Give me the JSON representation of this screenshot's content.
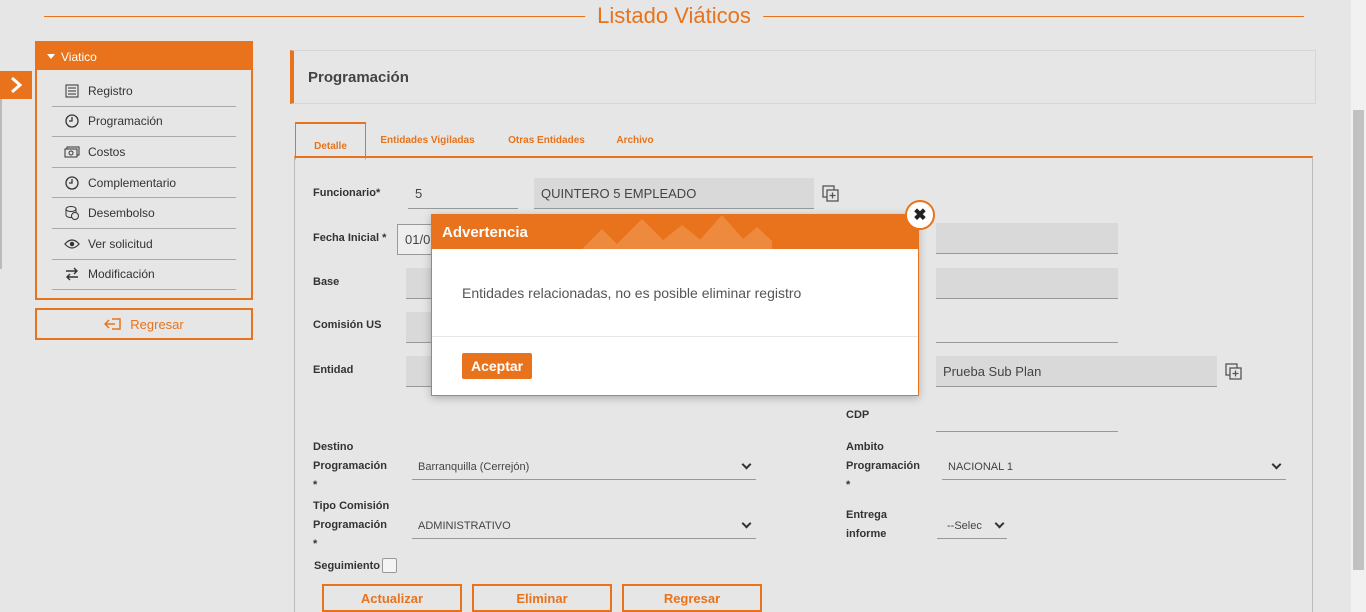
{
  "page": {
    "title": "Listado Viáticos"
  },
  "sidebar": {
    "header": "Viatico",
    "items": [
      {
        "label": "Registro",
        "icon": "list-icon"
      },
      {
        "label": "Programación",
        "icon": "clock-icon"
      },
      {
        "label": "Costos",
        "icon": "money-icon"
      },
      {
        "label": "Complementario",
        "icon": "clock-icon"
      },
      {
        "label": "Desembolso",
        "icon": "coins-icon"
      },
      {
        "label": "Ver solicitud",
        "icon": "eye-icon"
      },
      {
        "label": "Modificación",
        "icon": "swap-icon"
      }
    ],
    "back_label": "Regresar"
  },
  "section": {
    "title": "Programación"
  },
  "tabs": [
    "Detalle",
    "Entidades Vigiladas",
    "Otras Entidades",
    "Archivo"
  ],
  "form": {
    "funcionario_label": "Funcionario*",
    "funcionario_id": "5",
    "funcionario_name": "QUINTERO 5 EMPLEADO",
    "fecha_inicial_label": "Fecha Inicial *",
    "fecha_inicial_value": "01/0",
    "base_label": "Base",
    "comision_label": "Comisión US",
    "entidad_label": "Entidad",
    "subplan_value": "Prueba Sub Plan",
    "cdp_label": "CDP",
    "destino_label_1": "Destino",
    "destino_label_2": "Programación",
    "destino_label_3": "*",
    "destino_value": "Barranquilla (Cerrejón)",
    "ambito_label_1": "Ambito",
    "ambito_label_2": "Programación",
    "ambito_label_3": "*",
    "ambito_value": "NACIONAL 1",
    "tipo_label_1": "Tipo Comisión",
    "tipo_label_2": "Programación",
    "tipo_label_3": "*",
    "tipo_value": "ADMINISTRATIVO",
    "entrega_label_1": "Entrega",
    "entrega_label_2": "informe",
    "entrega_value": "--Selec",
    "seguimiento_label": "Seguimiento"
  },
  "buttons": {
    "update": "Actualizar",
    "delete": "Eliminar",
    "back": "Regresar"
  },
  "modal": {
    "title": "Advertencia",
    "message": "Entidades relacionadas, no es posible eliminar registro",
    "accept": "Aceptar",
    "close": "✖"
  },
  "colors": {
    "accent": "#e8731c",
    "background": "#e6e6e6"
  }
}
